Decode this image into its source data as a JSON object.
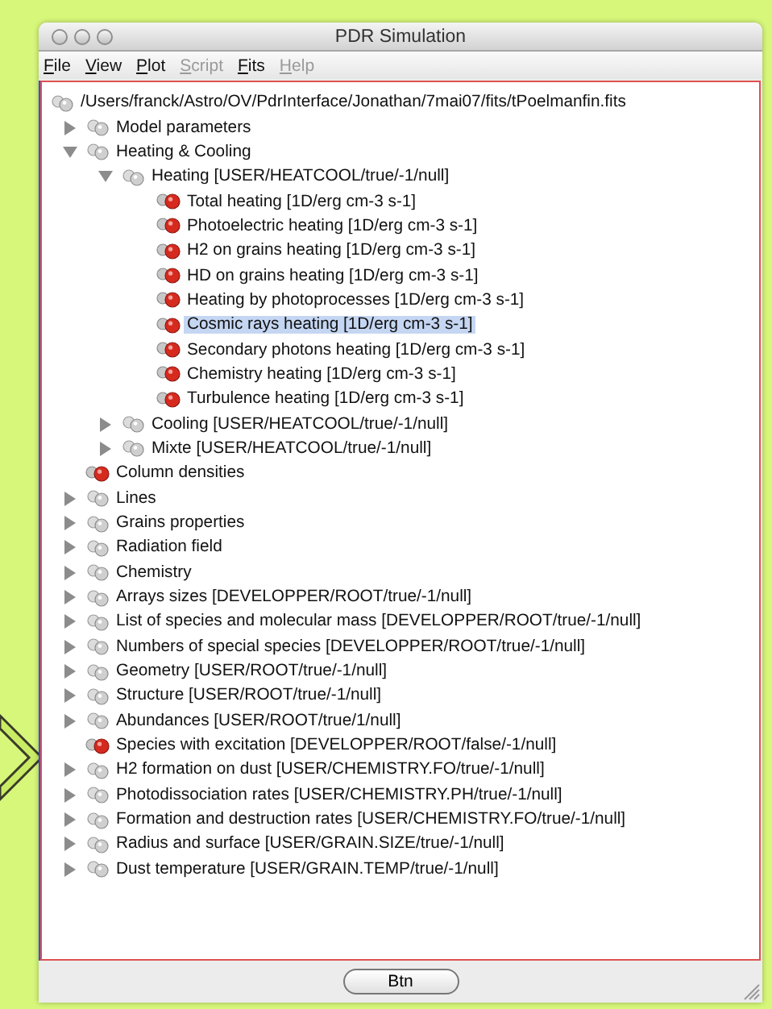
{
  "window": {
    "title": "PDR Simulation"
  },
  "menu": [
    {
      "label": "File",
      "disabled": false
    },
    {
      "label": "View",
      "disabled": false
    },
    {
      "label": "Plot",
      "disabled": false
    },
    {
      "label": "Script",
      "disabled": true
    },
    {
      "label": "Fits",
      "disabled": false
    },
    {
      "label": "Help",
      "disabled": true
    }
  ],
  "tree": {
    "label": "/Users/franck/Astro/OV/PdrInterface/Jonathan/7mai07/fits/tPoelmanfin.fits",
    "kind": "root",
    "selected": false,
    "children": [
      {
        "label": "Model parameters",
        "kind": "group",
        "expanded": false,
        "selected": false
      },
      {
        "label": "Heating & Cooling",
        "kind": "group",
        "expanded": true,
        "selected": false,
        "children": [
          {
            "label": "Heating [USER/HEATCOOL/true/-1/null]",
            "kind": "group",
            "expanded": true,
            "selected": false,
            "children": [
              {
                "label": "Total heating [1D/erg cm-3 s-1]",
                "kind": "data",
                "selected": false
              },
              {
                "label": "Photoelectric heating [1D/erg cm-3 s-1]",
                "kind": "data",
                "selected": false
              },
              {
                "label": "H2 on grains heating [1D/erg cm-3 s-1]",
                "kind": "data",
                "selected": false
              },
              {
                "label": "HD on grains heating [1D/erg cm-3 s-1]",
                "kind": "data",
                "selected": false
              },
              {
                "label": "Heating by photoprocesses [1D/erg cm-3 s-1]",
                "kind": "data",
                "selected": false
              },
              {
                "label": "Cosmic rays heating [1D/erg cm-3 s-1]",
                "kind": "data",
                "selected": true
              },
              {
                "label": "Secondary photons heating [1D/erg cm-3 s-1]",
                "kind": "data",
                "selected": false
              },
              {
                "label": "Chemistry heating [1D/erg cm-3 s-1]",
                "kind": "data",
                "selected": false
              },
              {
                "label": "Turbulence heating [1D/erg cm-3 s-1]",
                "kind": "data",
                "selected": false
              }
            ]
          },
          {
            "label": "Cooling [USER/HEATCOOL/true/-1/null]",
            "kind": "group",
            "expanded": false,
            "selected": false
          },
          {
            "label": "Mixte [USER/HEATCOOL/true/-1/null]",
            "kind": "group",
            "expanded": false,
            "selected": false
          }
        ]
      },
      {
        "label": "Column densities",
        "kind": "data",
        "selected": false
      },
      {
        "label": "Lines",
        "kind": "group",
        "expanded": false,
        "selected": false
      },
      {
        "label": "Grains properties",
        "kind": "group",
        "expanded": false,
        "selected": false
      },
      {
        "label": "Radiation field",
        "kind": "group",
        "expanded": false,
        "selected": false
      },
      {
        "label": "Chemistry",
        "kind": "group",
        "expanded": false,
        "selected": false
      },
      {
        "label": "Arrays sizes [DEVELOPPER/ROOT/true/-1/null]",
        "kind": "group",
        "expanded": false,
        "selected": false
      },
      {
        "label": "List of species and molecular mass [DEVELOPPER/ROOT/true/-1/null]",
        "kind": "group",
        "expanded": false,
        "selected": false
      },
      {
        "label": "Numbers of special species [DEVELOPPER/ROOT/true/-1/null]",
        "kind": "group",
        "expanded": false,
        "selected": false
      },
      {
        "label": "Geometry [USER/ROOT/true/-1/null]",
        "kind": "group",
        "expanded": false,
        "selected": false
      },
      {
        "label": "Structure [USER/ROOT/true/-1/null]",
        "kind": "group",
        "expanded": false,
        "selected": false
      },
      {
        "label": "Abundances [USER/ROOT/true/1/null]",
        "kind": "group",
        "expanded": false,
        "selected": false
      },
      {
        "label": "Species with excitation [DEVELOPPER/ROOT/false/-1/null]",
        "kind": "data",
        "selected": false
      },
      {
        "label": "H2 formation on dust [USER/CHEMISTRY.FO/true/-1/null]",
        "kind": "group",
        "expanded": false,
        "selected": false
      },
      {
        "label": "Photodissociation rates [USER/CHEMISTRY.PH/true/-1/null]",
        "kind": "group",
        "expanded": false,
        "selected": false
      },
      {
        "label": "Formation and destruction rates [USER/CHEMISTRY.FO/true/-1/null]",
        "kind": "group",
        "expanded": false,
        "selected": false
      },
      {
        "label": "Radius and surface [USER/GRAIN.SIZE/true/-1/null]",
        "kind": "group",
        "expanded": false,
        "selected": false
      },
      {
        "label": "Dust temperature [USER/GRAIN.TEMP/true/-1/null]",
        "kind": "group",
        "expanded": false,
        "selected": false
      }
    ]
  },
  "button": "Btn"
}
